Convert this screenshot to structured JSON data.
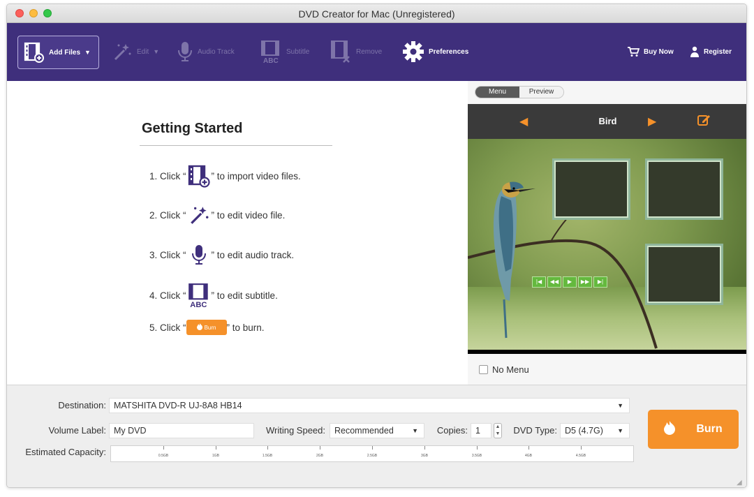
{
  "window": {
    "title": "DVD Creator for Mac (Unregistered)"
  },
  "toolbar": {
    "add_files": "Add Files",
    "edit": "Edit",
    "audio_track": "Audio Track",
    "subtitle": "Subtitle",
    "remove": "Remove",
    "preferences": "Preferences",
    "buy_now": "Buy Now",
    "register": "Register"
  },
  "getting_started": {
    "title": "Getting Started",
    "steps": [
      {
        "prefix": "1. Click “",
        "suffix": "” to import video files.",
        "icon": "add-files-icon"
      },
      {
        "prefix": "2. Click “",
        "suffix": "” to edit video file.",
        "icon": "magic-wand-icon"
      },
      {
        "prefix": "3. Click “",
        "suffix": "” to edit audio track.",
        "icon": "microphone-icon"
      },
      {
        "prefix": "4. Click “",
        "suffix": "” to edit subtitle.",
        "icon": "subtitle-icon"
      },
      {
        "prefix": "5. Click “",
        "suffix": "” to burn.",
        "icon": "burn-icon",
        "button_label": "Burn"
      }
    ]
  },
  "preview_panel": {
    "tabs": [
      "Menu",
      "Preview"
    ],
    "active_tab": "Menu",
    "menu_title": "Bird",
    "no_menu_label": "No Menu"
  },
  "bottom": {
    "destination_label": "Destination:",
    "destination_value": "MATSHITA DVD-R   UJ-8A8 HB14",
    "volume_label_label": "Volume Label:",
    "volume_label_value": "My DVD",
    "writing_speed_label": "Writing Speed:",
    "writing_speed_value": "Recommended",
    "copies_label": "Copies:",
    "copies_value": "1",
    "dvd_type_label": "DVD Type:",
    "dvd_type_value": "D5 (4.7G)",
    "estimated_capacity_label": "Estimated Capacity:",
    "capacity_ticks": [
      "0.5GB",
      "1GB",
      "1.5GB",
      "2GB",
      "2.5GB",
      "3GB",
      "3.5GB",
      "4GB",
      "4.5GB"
    ],
    "burn_label": "Burn"
  },
  "colors": {
    "toolbar": "#3f2f7c",
    "accent_orange": "#f5912a",
    "control_green": "#64b93e"
  }
}
